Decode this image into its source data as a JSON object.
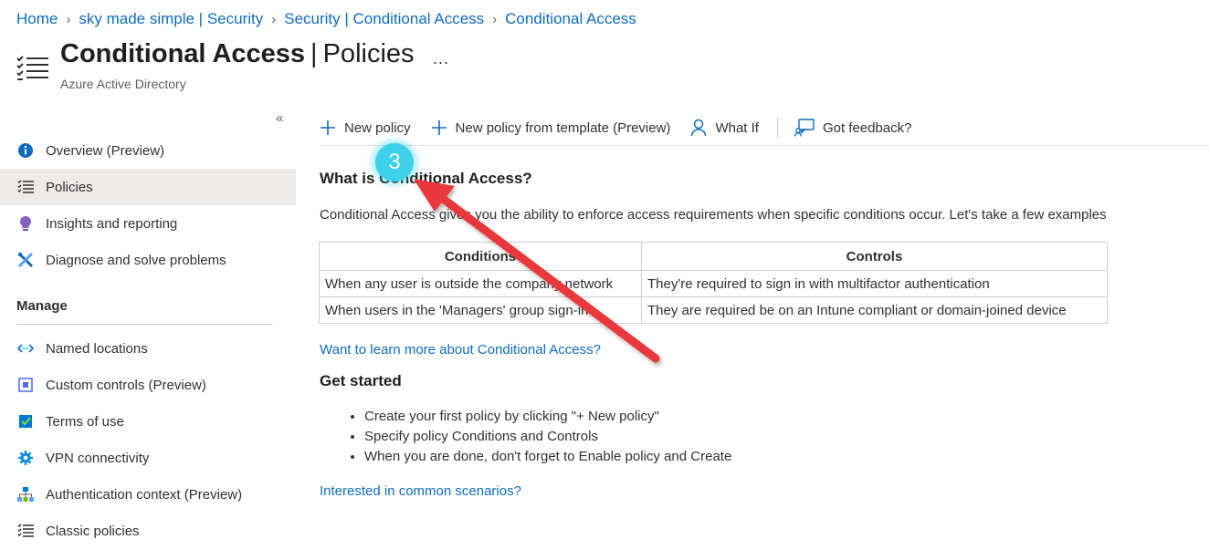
{
  "breadcrumb": [
    "Home",
    "sky made simple | Security",
    "Security | Conditional Access",
    "Conditional Access"
  ],
  "header": {
    "title": "Conditional Access",
    "section": "Policies",
    "more": "...",
    "subtitle": "Azure Active Directory"
  },
  "sidebar": {
    "collapse_glyph": "«",
    "items": [
      {
        "label": "Overview (Preview)",
        "icon": "info-icon"
      },
      {
        "label": "Policies",
        "icon": "list-icon",
        "active": true
      },
      {
        "label": "Insights and reporting",
        "icon": "lightbulb-icon"
      },
      {
        "label": "Diagnose and solve problems",
        "icon": "wrench-icon"
      }
    ],
    "manage_title": "Manage",
    "manage_items": [
      {
        "label": "Named locations",
        "icon": "network-icon"
      },
      {
        "label": "Custom controls (Preview)",
        "icon": "custom-controls-icon"
      },
      {
        "label": "Terms of use",
        "icon": "checklist-icon"
      },
      {
        "label": "VPN connectivity",
        "icon": "gear-icon"
      },
      {
        "label": "Authentication context (Preview)",
        "icon": "hierarchy-icon"
      },
      {
        "label": "Classic policies",
        "icon": "list-icon"
      }
    ]
  },
  "commands": {
    "new_policy": "New policy",
    "new_from_template": "New policy from template (Preview)",
    "what_if": "What If",
    "feedback": "Got feedback?"
  },
  "content": {
    "heading": "What is Conditional Access?",
    "intro": "Conditional Access gives you the ability to enforce access requirements when specific conditions occur. Let's take a few examples",
    "table": {
      "headers": [
        "Conditions",
        "Controls"
      ],
      "rows": [
        [
          "When any user is outside the company network",
          "They're required to sign in with multifactor authentication"
        ],
        [
          "When users in the 'Managers' group sign-in",
          "They are required be on an Intune compliant or domain-joined device"
        ]
      ]
    },
    "learn_link": "Want to learn more about Conditional Access?",
    "get_started": "Get started",
    "steps": [
      "Create your first policy by clicking \"+ New policy\"",
      "Specify policy Conditions and Controls",
      "When you are done, don't forget to Enable policy and Create"
    ],
    "scenarios_link": "Interested in common scenarios?"
  },
  "annotation": {
    "step_number": "3",
    "badge_color": "#3dd1e8",
    "arrow_color": "#e8383d"
  },
  "colors": {
    "link": "#0f6cbd",
    "active_nav": "#edebe9",
    "text": "#323130"
  }
}
